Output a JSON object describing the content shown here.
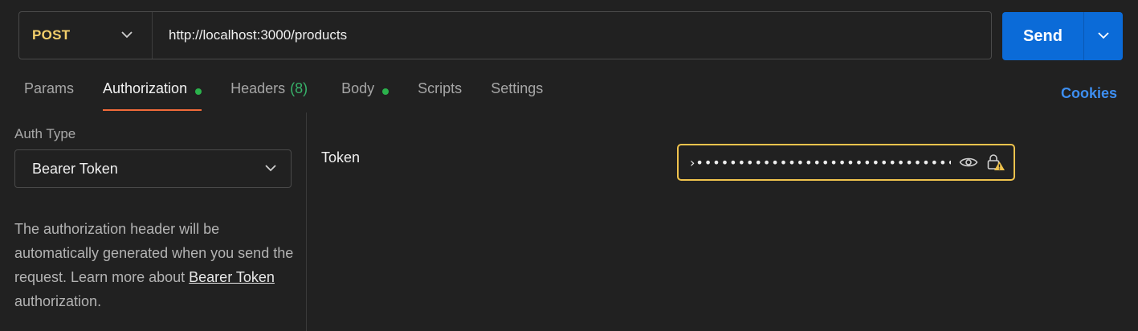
{
  "request": {
    "method": "POST",
    "url": "http://localhost:3000/products",
    "send_label": "Send"
  },
  "tabs": [
    {
      "label": "Params"
    },
    {
      "label": "Authorization",
      "active": true,
      "dot": true
    },
    {
      "label": "Headers",
      "count": "(8)"
    },
    {
      "label": "Body",
      "dot": true
    },
    {
      "label": "Scripts"
    },
    {
      "label": "Settings"
    }
  ],
  "cookies_label": "Cookies",
  "auth": {
    "type_label": "Auth Type",
    "type_value": "Bearer Token",
    "description_prefix": "The authorization header will be automatically generated when you send the request. Learn more about",
    "description_link": "Bearer Token",
    "description_suffix": "authorization."
  },
  "token": {
    "label": "Token",
    "masked_value": "›•••••••••••••••••••••••••••••••"
  },
  "icons": [
    "chevron-down-icon",
    "eye-icon",
    "lock-warning-icon"
  ],
  "colors": {
    "method": "#f3cf6b",
    "send_button": "#0b6bd8",
    "active_tab_underline": "#f26b3a",
    "status_dot": "#2bb24c",
    "link": "#3d8ef0",
    "token_border": "#f0c34d"
  }
}
